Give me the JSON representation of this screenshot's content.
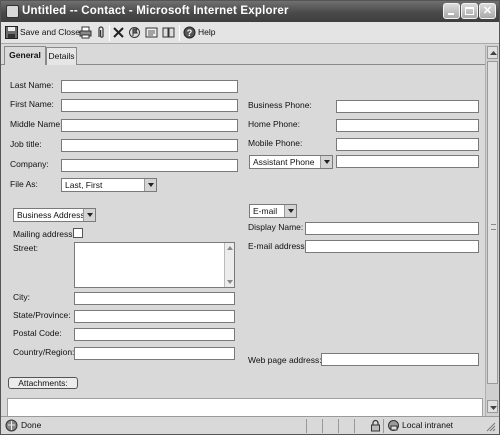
{
  "window": {
    "title": "Untitled -- Contact - Microsoft Internet Explorer"
  },
  "toolbar": {
    "save_close_label": "Save and Close",
    "help_label": "Help"
  },
  "tabs": [
    {
      "label": "General",
      "active": true
    },
    {
      "label": "Details",
      "active": false
    }
  ],
  "form": {
    "last_name": {
      "label": "Last Name:",
      "value": ""
    },
    "first_name": {
      "label": "First Name:",
      "value": ""
    },
    "middle_name": {
      "label": "Middle Name:",
      "value": ""
    },
    "job_title": {
      "label": "Job title:",
      "value": ""
    },
    "company": {
      "label": "Company:",
      "value": ""
    },
    "file_as": {
      "label": "File As:",
      "selected": "Last, First"
    },
    "business_phone": {
      "label": "Business Phone:",
      "value": ""
    },
    "home_phone": {
      "label": "Home Phone:",
      "value": ""
    },
    "mobile_phone": {
      "label": "Mobile Phone:",
      "value": ""
    },
    "phone_type_select": {
      "selected": "Assistant Phone",
      "value": ""
    },
    "address_type_select": {
      "selected": "Business Address"
    },
    "mailing_address": {
      "label": "Mailing address",
      "checked": false
    },
    "street": {
      "label": "Street:",
      "value": ""
    },
    "city": {
      "label": "City:",
      "value": ""
    },
    "state": {
      "label": "State/Province:",
      "value": ""
    },
    "postal_code": {
      "label": "Postal Code:",
      "value": ""
    },
    "country": {
      "label": "Country/Region:",
      "value": ""
    },
    "email_select": {
      "selected": "E-mail"
    },
    "display_name": {
      "label": "Display Name:",
      "value": ""
    },
    "email_address": {
      "label": "E-mail address:",
      "value": ""
    },
    "web_page": {
      "label": "Web page address:",
      "value": ""
    },
    "attachments_button": "Attachments:"
  },
  "status_bar": {
    "status_text": "Done",
    "zone_text": "Local intranet"
  },
  "colors": {
    "title_bar": "#4a4a4a",
    "form_background": "#d9d9d9",
    "field_background": "#ffffff"
  },
  "icons": [
    "app-icon",
    "save-icon",
    "print-icon",
    "attach-icon",
    "delete-icon",
    "flag-icon",
    "address-book-icon",
    "contacts-icon",
    "help-icon",
    "page-icon",
    "lock-icon",
    "intranet-icon"
  ]
}
